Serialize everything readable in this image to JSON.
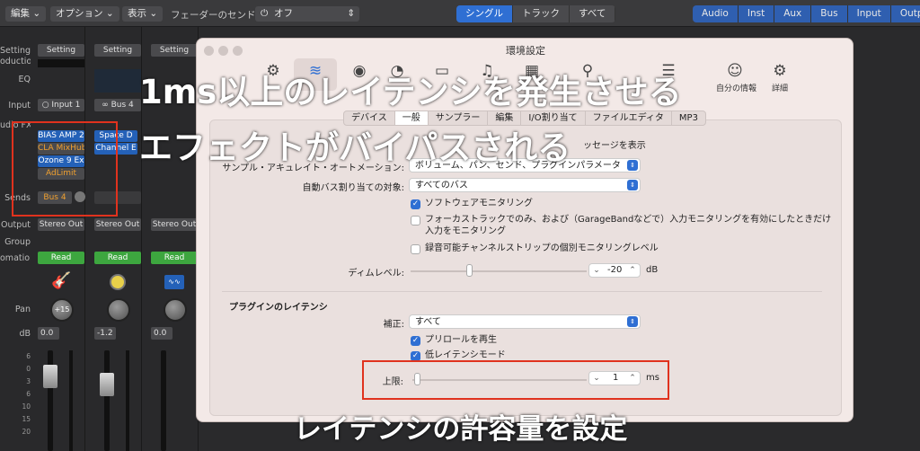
{
  "toolbar": {
    "edit": "編集",
    "options": "オプション",
    "view": "表示",
    "fader_send_label": "フェーダーのセンド:",
    "fader_send_value": "オフ",
    "view_modes": [
      "シングル",
      "トラック",
      "すべて"
    ],
    "filters": [
      "Audio",
      "Inst",
      "Aux",
      "Bus",
      "Input",
      "Output"
    ]
  },
  "mixer": {
    "row_labels": [
      "Setting",
      "oduction",
      "EQ",
      "Input",
      "udio FX",
      "Sends",
      "Output",
      "Group",
      "omation",
      "Pan",
      "dB"
    ],
    "strips": [
      {
        "setting": "Setting",
        "input": "Input 1",
        "plugins": [
          "BIAS AMP 2",
          "CLA MixHub",
          "Ozone 9 Ex",
          "AdLimit"
        ],
        "send": "Bus 4",
        "output": "Stereo Out",
        "automation": "Read",
        "pan": "+15",
        "db": "0.0"
      },
      {
        "setting": "Setting",
        "input": "Bus 4",
        "plugins": [
          "Space D",
          "Channel E"
        ],
        "send": "",
        "output": "Stereo Out",
        "automation": "Read",
        "pan": "",
        "db": "-1.2"
      },
      {
        "setting": "Setting",
        "input": "",
        "plugins": [],
        "send": "",
        "output": "Stereo Out",
        "automation": "Read",
        "pan": "",
        "db": "0.0"
      }
    ],
    "fader_scale": [
      "6",
      "0",
      "3",
      "6",
      "10",
      "15",
      "20"
    ]
  },
  "prefs": {
    "window_title": "環境設定",
    "toolbar_items": [
      "自分の情報",
      "詳細"
    ],
    "tabs": [
      "デバイス",
      "一般",
      "サンプラー",
      "編集",
      "I/O割り当て",
      "ファイルエディタ",
      "MP3"
    ],
    "active_tab": "一般",
    "partial_message": "ッセージを表示",
    "sample_accurate_label": "サンプル・アキュレイト・オートメーション:",
    "sample_accurate_value": "ボリューム、パン、センド、プラグインパラメータ",
    "auto_bus_label": "自動バス割り当ての対象:",
    "auto_bus_value": "すべてのバス",
    "software_monitoring": "ソフトウェアモニタリング",
    "focus_track_line1": "フォーカストラックでのみ、および（GarageBandなどで）入力モニタリングを有効にしたときだけ",
    "focus_track_line2": "入力をモニタリング",
    "record_monitoring": "録音可能チャンネルストリップの個別モニタリングレベル",
    "dim_label": "ディムレベル:",
    "dim_value": "-20",
    "dim_unit": "dB",
    "latency_section": "プラグインのレイテンシ",
    "compensation_label": "補正:",
    "compensation_value": "すべて",
    "preroll": "プリロールを再生",
    "low_latency": "低レイテンシモード",
    "limit_label": "上限:",
    "limit_value": "1",
    "limit_unit": "ms"
  },
  "annotations": {
    "headline1": "1ms以上のレイテンシを発生させる",
    "headline2": "エフェクトがバイパスされる",
    "caption": "レイテンシの許容量を設定",
    "color": "#e0321e"
  }
}
